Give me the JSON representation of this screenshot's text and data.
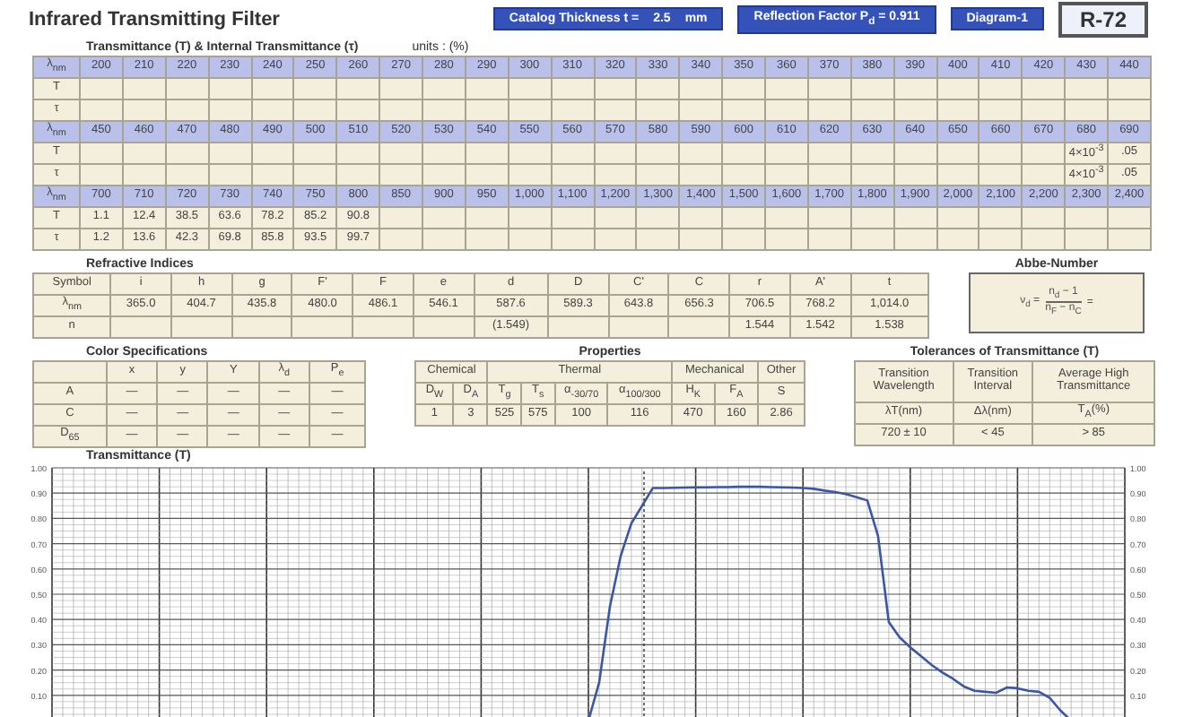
{
  "header": {
    "title": "Infrared Transmitting Filter",
    "badges": [
      [
        "Catalog Thickness t =",
        "2.5",
        "mm"
      ],
      [
        "Reflection Factor P$_{d}$ = 0.911"
      ],
      [
        "Diagram-1"
      ]
    ],
    "code": "R-72"
  },
  "transmittance": {
    "title": "Transmittance (T) & Internal Transmittance (τ)",
    "units": "units : (%)",
    "blocks": [
      {
        "row_labels": [
          "λ$_{nm}$",
          "T",
          "τ"
        ],
        "columns": [
          {
            "wavelength": "200"
          },
          {
            "wavelength": "210"
          },
          {
            "wavelength": "220"
          },
          {
            "wavelength": "230"
          },
          {
            "wavelength": "240"
          },
          {
            "wavelength": "250"
          },
          {
            "wavelength": "260"
          },
          {
            "wavelength": "270"
          },
          {
            "wavelength": "280"
          },
          {
            "wavelength": "290"
          },
          {
            "wavelength": "300"
          },
          {
            "wavelength": "310"
          },
          {
            "wavelength": "320"
          },
          {
            "wavelength": "330"
          },
          {
            "wavelength": "340"
          },
          {
            "wavelength": "350"
          },
          {
            "wavelength": "360"
          },
          {
            "wavelength": "370"
          },
          {
            "wavelength": "380"
          },
          {
            "wavelength": "390"
          },
          {
            "wavelength": "400"
          },
          {
            "wavelength": "410"
          },
          {
            "wavelength": "420"
          },
          {
            "wavelength": "430"
          },
          {
            "wavelength": "440"
          }
        ]
      },
      {
        "row_labels": [
          "λ$_{nm}$",
          "T",
          "τ"
        ],
        "columns": [
          {
            "wavelength": "450"
          },
          {
            "wavelength": "460"
          },
          {
            "wavelength": "470"
          },
          {
            "wavelength": "480"
          },
          {
            "wavelength": "490"
          },
          {
            "wavelength": "500"
          },
          {
            "wavelength": "510"
          },
          {
            "wavelength": "520"
          },
          {
            "wavelength": "530"
          },
          {
            "wavelength": "540"
          },
          {
            "wavelength": "550"
          },
          {
            "wavelength": "560"
          },
          {
            "wavelength": "570"
          },
          {
            "wavelength": "580"
          },
          {
            "wavelength": "590"
          },
          {
            "wavelength": "600"
          },
          {
            "wavelength": "610"
          },
          {
            "wavelength": "620"
          },
          {
            "wavelength": "630"
          },
          {
            "wavelength": "640"
          },
          {
            "wavelength": "650"
          },
          {
            "wavelength": "660"
          },
          {
            "wavelength": "670"
          },
          {
            "wavelength": "680",
            "T": "4×10$^{-3}$",
            "tau": "4×10$^{-3}$"
          },
          {
            "wavelength": "690",
            "T": ".05",
            "tau": ".05"
          }
        ]
      },
      {
        "row_labels": [
          "λ$_{nm}$",
          "T",
          "τ"
        ],
        "columns": [
          {
            "wavelength": "700",
            "T": "1.1",
            "tau": "1.2"
          },
          {
            "wavelength": "710",
            "T": "12.4",
            "tau": "13.6"
          },
          {
            "wavelength": "720",
            "T": "38.5",
            "tau": "42.3"
          },
          {
            "wavelength": "730",
            "T": "63.6",
            "tau": "69.8"
          },
          {
            "wavelength": "740",
            "T": "78.2",
            "tau": "85.8"
          },
          {
            "wavelength": "750",
            "T": "85.2",
            "tau": "93.5"
          },
          {
            "wavelength": "800",
            "T": "90.8",
            "tau": "99.7"
          },
          {
            "wavelength": "850"
          },
          {
            "wavelength": "900"
          },
          {
            "wavelength": "950"
          },
          {
            "wavelength": "1,000"
          },
          {
            "wavelength": "1,100"
          },
          {
            "wavelength": "1,200"
          },
          {
            "wavelength": "1,300"
          },
          {
            "wavelength": "1,400"
          },
          {
            "wavelength": "1,500"
          },
          {
            "wavelength": "1,600"
          },
          {
            "wavelength": "1,700"
          },
          {
            "wavelength": "1,800"
          },
          {
            "wavelength": "1,900"
          },
          {
            "wavelength": "2,000"
          },
          {
            "wavelength": "2,100"
          },
          {
            "wavelength": "2,200"
          },
          {
            "wavelength": "2,300"
          },
          {
            "wavelength": "2,400"
          }
        ]
      }
    ]
  },
  "refractive": {
    "title": "Refractive Indices",
    "row_labels": [
      "Symbol",
      "λ$_{nm}$",
      "n"
    ],
    "columns": [
      {
        "symbol": "i",
        "wavelength": "365.0"
      },
      {
        "symbol": "h",
        "wavelength": "404.7"
      },
      {
        "symbol": "g",
        "wavelength": "435.8"
      },
      {
        "symbol": "F'",
        "wavelength": "480.0"
      },
      {
        "symbol": "F",
        "wavelength": "486.1"
      },
      {
        "symbol": "e",
        "wavelength": "546.1"
      },
      {
        "symbol": "d",
        "wavelength": "587.6",
        "n": "(1.549)"
      },
      {
        "symbol": "D",
        "wavelength": "589.3"
      },
      {
        "symbol": "C'",
        "wavelength": "643.8"
      },
      {
        "symbol": "C",
        "wavelength": "656.3"
      },
      {
        "symbol": "r",
        "wavelength": "706.5",
        "n": "1.544"
      },
      {
        "symbol": "A'",
        "wavelength": "768.2",
        "n": "1.542"
      },
      {
        "symbol": "t",
        "wavelength": "1,014.0",
        "n": "1.538"
      }
    ]
  },
  "abbe": {
    "title": "Abbe-Number",
    "lhs": "ν$_{d}$ =",
    "numerator": "n$_{d}$ − 1",
    "denominator": "n$_{F}$ − n$_{C}$",
    "rhs": "="
  },
  "color_specs": {
    "title": "Color Specifications",
    "columns": [
      "x",
      "y",
      "Y",
      "λ$_{d}$",
      "P$_{e}$"
    ],
    "rows": [
      {
        "label": "A",
        "values": [
          "—",
          "—",
          "—",
          "—",
          "—"
        ]
      },
      {
        "label": "C",
        "values": [
          "—",
          "—",
          "—",
          "—",
          "—"
        ]
      },
      {
        "label": "D$_{65}$",
        "values": [
          "—",
          "—",
          "—",
          "—",
          "—"
        ]
      }
    ]
  },
  "properties": {
    "title": "Properties",
    "groups": [
      {
        "label": "Chemical",
        "columns": [
          "D$_{W}$",
          "D$_{A}$"
        ],
        "values": [
          "1",
          "3"
        ]
      },
      {
        "label": "Thermal",
        "columns": [
          "T$_{g}$",
          "T$_{s}$",
          "α$_{-30/70}$",
          "α$_{100/300}$"
        ],
        "values": [
          "525",
          "575",
          "100",
          "116"
        ]
      },
      {
        "label": "Mechanical",
        "columns": [
          "H$_{K}$",
          "F$_{A}$"
        ],
        "values": [
          "470",
          "160"
        ]
      },
      {
        "label": "Other",
        "columns": [
          "S"
        ],
        "values": [
          "2.86"
        ]
      }
    ]
  },
  "tolerances": {
    "title": "Tolerances of Transmittance (T)",
    "columns": [
      {
        "heading": "Transition Wavelength",
        "unit": "λT(nm)",
        "value": "720 ± 10"
      },
      {
        "heading": "Transition Interval",
        "unit": "Δλ(nm)",
        "value": "< 45"
      },
      {
        "heading": "Average High Transmittance",
        "unit": "T$_{A}$(%)",
        "value": "> 85"
      }
    ]
  },
  "chart": {
    "right_yticks": [
      "1.00",
      "0.90",
      "0.80",
      "0.70",
      "0.60",
      "0.50",
      "0.40",
      "0.30",
      "0.20",
      "0.10"
    ],
    "chart_data": {
      "type": "line",
      "title": "Transmittance (T)",
      "grid": true,
      "categories": [
        null,
        null,
        null,
        null,
        null,
        null,
        null,
        null,
        null,
        null,
        null,
        null,
        null,
        null,
        null,
        null,
        null,
        null,
        null,
        null,
        null,
        null,
        null,
        null,
        null,
        null,
        null,
        null,
        null,
        null,
        null,
        null,
        null,
        null,
        null,
        null,
        null,
        null,
        null,
        null,
        null,
        null,
        null,
        null,
        null,
        null,
        null,
        null,
        null,
        null,
        null,
        null,
        null,
        null,
        null,
        null,
        null,
        null,
        null,
        null,
        null,
        null,
        null,
        null,
        null,
        null,
        null,
        null,
        null,
        null,
        null,
        null,
        null,
        null,
        null,
        null,
        null,
        null,
        null,
        null,
        null,
        null,
        null,
        null,
        null,
        null,
        null,
        null,
        null,
        null,
        null,
        null,
        null,
        null,
        null,
        null,
        null,
        null,
        null,
        null,
        null
      ],
      "ylim": [
        0,
        1
      ],
      "series": [
        {
          "color": "#3a56a8",
          "values": [
            null,
            null,
            null,
            null,
            null,
            null,
            null,
            null,
            null,
            null,
            null,
            null,
            null,
            null,
            null,
            null,
            null,
            null,
            null,
            null,
            null,
            null,
            null,
            null,
            null,
            null,
            null,
            null,
            null,
            null,
            null,
            null,
            null,
            null,
            null,
            null,
            null,
            null,
            null,
            null,
            null,
            null,
            null,
            null,
            null,
            null,
            null,
            null,
            null,
            null,
            0,
            0.15,
            0.45,
            0.65,
            0.78,
            0.85,
            0.92,
            0.92,
            0.921,
            0.922,
            0.923,
            0.923,
            0.924,
            0.924,
            0.925,
            0.925,
            0.925,
            0.924,
            0.923,
            0.922,
            0.92,
            0.917,
            0.91,
            0.904,
            0.896,
            0.884,
            0.871,
            0.73,
            0.39,
            0.33,
            0.29,
            0.255,
            0.22,
            0.19,
            0.165,
            0.135,
            0.118,
            0.114,
            0.11,
            0.131,
            0.128,
            0.118,
            0.114,
            0.09,
            0.04,
            0,
            null,
            null,
            null,
            null,
            null
          ]
        }
      ],
      "yticks": [
        {
          "value": 1.0,
          "label": "1.00"
        },
        {
          "value": 0.9,
          "label": "0.90"
        },
        {
          "value": 0.8,
          "label": "0.80"
        },
        {
          "value": 0.7,
          "label": "0.70"
        },
        {
          "value": 0.6,
          "label": "0.60"
        },
        {
          "value": 0.5,
          "label": "0.50"
        },
        {
          "value": 0.4,
          "label": "0.40"
        },
        {
          "value": 0.3,
          "label": "0.30"
        },
        {
          "value": 0.2,
          "label": "0.20"
        },
        {
          "value": 0.1,
          "label": "0.10"
        }
      ]
    }
  }
}
